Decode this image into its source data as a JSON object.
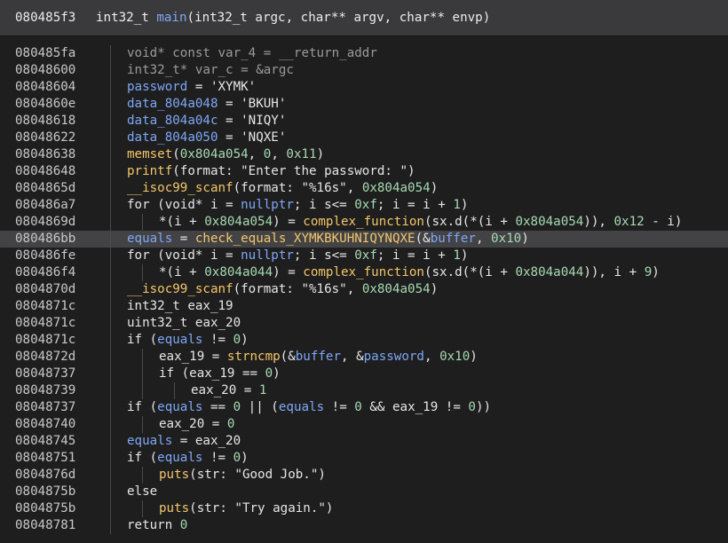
{
  "header": {
    "address": "080485f3",
    "return_type": "int32_t",
    "function_name": "main",
    "params": [
      {
        "type": "int32_t",
        "name": "argc"
      },
      {
        "type": "char**",
        "name": "argv"
      },
      {
        "type": "char**",
        "name": "envp"
      }
    ]
  },
  "lines": [
    {
      "address": "080485fa",
      "indent": 0,
      "tokens": [
        [
          "dim",
          "void* const var_4 = __return_addr"
        ]
      ]
    },
    {
      "address": "08048600",
      "indent": 0,
      "tokens": [
        [
          "dim",
          "int32_t* var_c = &argc"
        ]
      ]
    },
    {
      "address": "08048604",
      "indent": 0,
      "tokens": [
        [
          "var",
          "password"
        ],
        [
          "kw",
          " = 'XYMK'"
        ]
      ]
    },
    {
      "address": "0804860e",
      "indent": 0,
      "tokens": [
        [
          "var",
          "data_804a048"
        ],
        [
          "kw",
          " = 'BKUH'"
        ]
      ]
    },
    {
      "address": "08048618",
      "indent": 0,
      "tokens": [
        [
          "var",
          "data_804a04c"
        ],
        [
          "kw",
          " = 'NIQY'"
        ]
      ]
    },
    {
      "address": "08048622",
      "indent": 0,
      "tokens": [
        [
          "var",
          "data_804a050"
        ],
        [
          "kw",
          " = 'NQXE'"
        ]
      ]
    },
    {
      "address": "08048638",
      "indent": 0,
      "tokens": [
        [
          "fn",
          "memset"
        ],
        [
          "kw",
          "("
        ],
        [
          "num",
          "0x804a054"
        ],
        [
          "kw",
          ", "
        ],
        [
          "num",
          "0"
        ],
        [
          "kw",
          ", "
        ],
        [
          "num",
          "0x11"
        ],
        [
          "kw",
          ")"
        ]
      ]
    },
    {
      "address": "08048648",
      "indent": 0,
      "tokens": [
        [
          "fn",
          "printf"
        ],
        [
          "kw",
          "(format: \"Enter the password: \")"
        ]
      ]
    },
    {
      "address": "0804865d",
      "indent": 0,
      "tokens": [
        [
          "fn",
          "__isoc99_scanf"
        ],
        [
          "kw",
          "(format: \"%16s\", "
        ],
        [
          "num",
          "0x804a054"
        ],
        [
          "kw",
          ")"
        ]
      ]
    },
    {
      "address": "080486a7",
      "indent": 0,
      "tokens": [
        [
          "kw",
          "for (void* i = "
        ],
        [
          "const",
          "nullptr"
        ],
        [
          "kw",
          "; i s<= "
        ],
        [
          "num",
          "0xf"
        ],
        [
          "kw",
          "; i = i + "
        ],
        [
          "num",
          "1"
        ],
        [
          "kw",
          ")"
        ]
      ]
    },
    {
      "address": "0804869d",
      "indent": 1,
      "tokens": [
        [
          "kw",
          "*(i + "
        ],
        [
          "num",
          "0x804a054"
        ],
        [
          "kw",
          ") = "
        ],
        [
          "fn",
          "complex_function"
        ],
        [
          "kw",
          "(sx.d(*(i + "
        ],
        [
          "num",
          "0x804a054"
        ],
        [
          "kw",
          ")), "
        ],
        [
          "num",
          "0x12"
        ],
        [
          "kw",
          " - i)"
        ]
      ]
    },
    {
      "address": "080486bb",
      "indent": 0,
      "highlight": true,
      "tokens": [
        [
          "var",
          "equals"
        ],
        [
          "kw",
          " = "
        ],
        [
          "fn",
          "check_equals_XYMKBKUHNIQYNQXE"
        ],
        [
          "kw",
          "(&"
        ],
        [
          "var",
          "buffer"
        ],
        [
          "kw",
          ", "
        ],
        [
          "num",
          "0x10"
        ],
        [
          "kw",
          ")"
        ]
      ]
    },
    {
      "address": "080486fe",
      "indent": 0,
      "tokens": [
        [
          "kw",
          "for (void* i = "
        ],
        [
          "const",
          "nullptr"
        ],
        [
          "kw",
          "; i s<= "
        ],
        [
          "num",
          "0xf"
        ],
        [
          "kw",
          "; i = i + "
        ],
        [
          "num",
          "1"
        ],
        [
          "kw",
          ")"
        ]
      ]
    },
    {
      "address": "080486f4",
      "indent": 1,
      "tokens": [
        [
          "kw",
          "*(i + "
        ],
        [
          "num",
          "0x804a044"
        ],
        [
          "kw",
          ") = "
        ],
        [
          "fn",
          "complex_function"
        ],
        [
          "kw",
          "(sx.d(*(i + "
        ],
        [
          "num",
          "0x804a044"
        ],
        [
          "kw",
          ")), i + "
        ],
        [
          "num",
          "9"
        ],
        [
          "kw",
          ")"
        ]
      ]
    },
    {
      "address": "0804870d",
      "indent": 0,
      "tokens": [
        [
          "fn",
          "__isoc99_scanf"
        ],
        [
          "kw",
          "(format: \"%16s\", "
        ],
        [
          "num",
          "0x804a054"
        ],
        [
          "kw",
          ")"
        ]
      ]
    },
    {
      "address": "0804871c",
      "indent": 0,
      "tokens": [
        [
          "kw",
          "int32_t eax_19"
        ]
      ]
    },
    {
      "address": "0804871c",
      "indent": 0,
      "tokens": [
        [
          "kw",
          "uint32_t eax_20"
        ]
      ]
    },
    {
      "address": "0804871c",
      "indent": 0,
      "tokens": [
        [
          "kw",
          "if ("
        ],
        [
          "var",
          "equals"
        ],
        [
          "kw",
          " != "
        ],
        [
          "num",
          "0"
        ],
        [
          "kw",
          ")"
        ]
      ]
    },
    {
      "address": "0804872d",
      "indent": 1,
      "tokens": [
        [
          "kw",
          "eax_19 = "
        ],
        [
          "fn",
          "strncmp"
        ],
        [
          "kw",
          "(&"
        ],
        [
          "var",
          "buffer"
        ],
        [
          "kw",
          ", &"
        ],
        [
          "var",
          "password"
        ],
        [
          "kw",
          ", "
        ],
        [
          "num",
          "0x10"
        ],
        [
          "kw",
          ")"
        ]
      ]
    },
    {
      "address": "08048737",
      "indent": 1,
      "tokens": [
        [
          "kw",
          "if (eax_19 == "
        ],
        [
          "num",
          "0"
        ],
        [
          "kw",
          ")"
        ]
      ]
    },
    {
      "address": "08048739",
      "indent": 2,
      "tokens": [
        [
          "kw",
          "eax_20 = "
        ],
        [
          "num",
          "1"
        ]
      ]
    },
    {
      "address": "08048737",
      "indent": 0,
      "tokens": [
        [
          "kw",
          "if ("
        ],
        [
          "var",
          "equals"
        ],
        [
          "kw",
          " == "
        ],
        [
          "num",
          "0"
        ],
        [
          "kw",
          " || ("
        ],
        [
          "var",
          "equals"
        ],
        [
          "kw",
          " != "
        ],
        [
          "num",
          "0"
        ],
        [
          "kw",
          " && eax_19 != "
        ],
        [
          "num",
          "0"
        ],
        [
          "kw",
          "))"
        ]
      ]
    },
    {
      "address": "08048740",
      "indent": 1,
      "tokens": [
        [
          "kw",
          "eax_20 = "
        ],
        [
          "num",
          "0"
        ]
      ]
    },
    {
      "address": "08048745",
      "indent": 0,
      "tokens": [
        [
          "var",
          "equals"
        ],
        [
          "kw",
          " = eax_20"
        ]
      ]
    },
    {
      "address": "08048751",
      "indent": 0,
      "tokens": [
        [
          "kw",
          "if ("
        ],
        [
          "var",
          "equals"
        ],
        [
          "kw",
          " != "
        ],
        [
          "num",
          "0"
        ],
        [
          "kw",
          ")"
        ]
      ]
    },
    {
      "address": "0804876d",
      "indent": 1,
      "tokens": [
        [
          "fn",
          "puts"
        ],
        [
          "kw",
          "(str: \"Good Job.\")"
        ]
      ]
    },
    {
      "address": "0804875b",
      "indent": 0,
      "tokens": [
        [
          "kw",
          "else"
        ]
      ]
    },
    {
      "address": "0804875b",
      "indent": 1,
      "tokens": [
        [
          "fn",
          "puts"
        ],
        [
          "kw",
          "(str: \"Try again.\")"
        ]
      ]
    },
    {
      "address": "08048781",
      "indent": 0,
      "tokens": [
        [
          "kw",
          "return "
        ],
        [
          "num",
          "0"
        ]
      ]
    }
  ]
}
